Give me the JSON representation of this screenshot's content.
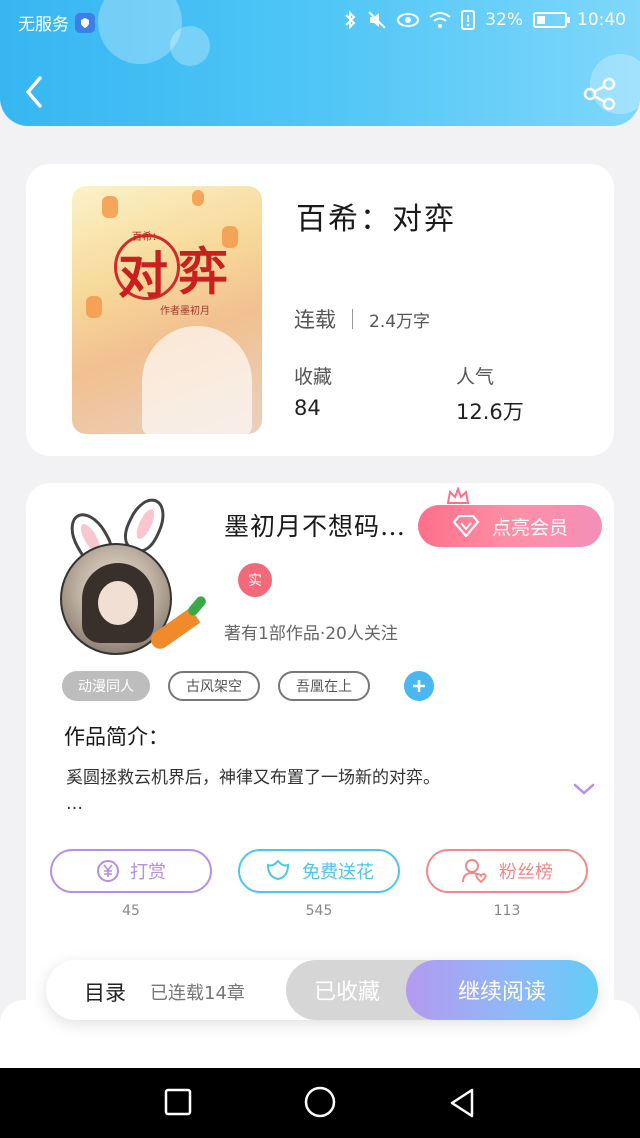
{
  "status_bar": {
    "carrier": "无服务",
    "battery": "32%",
    "battery_level": 0.32,
    "time": "10:40"
  },
  "header": {
    "back_icon": "chevron-left-icon",
    "share_icon": "share-icon"
  },
  "book": {
    "cover_small": "百希：",
    "cover_title_1": "对",
    "cover_title_2": "弈",
    "cover_author": "作者墨初月",
    "title": "百希：对弈",
    "status": "连载",
    "word_count": "2.4万字",
    "favorites_label": "收藏",
    "favorites_value": "84",
    "popularity_label": "人气",
    "popularity_value": "12.6万"
  },
  "author": {
    "name": "墨初月不想码…",
    "vip_button": "点亮会员",
    "badge": "实",
    "meta": "著有1部作品·20人关注"
  },
  "tags": [
    "动漫同人",
    "古风架空",
    "吾凰在上"
  ],
  "intro": {
    "title": "作品简介：",
    "text": "奚圆拯救云机界后，神律又布置了一场新的对弈。",
    "ellipsis": "…"
  },
  "actions": [
    {
      "label": "打赏",
      "count": "45",
      "color": "#b58ee8"
    },
    {
      "label": "免费送花",
      "count": "545",
      "color": "#4dc6e8"
    },
    {
      "label": "粉丝榜",
      "count": "113",
      "color": "#f08a8a"
    }
  ],
  "bottom_bar": {
    "toc_label": "目录",
    "toc_count": "已连载14章",
    "collected_label": "已收藏",
    "read_label": "继续阅读"
  }
}
